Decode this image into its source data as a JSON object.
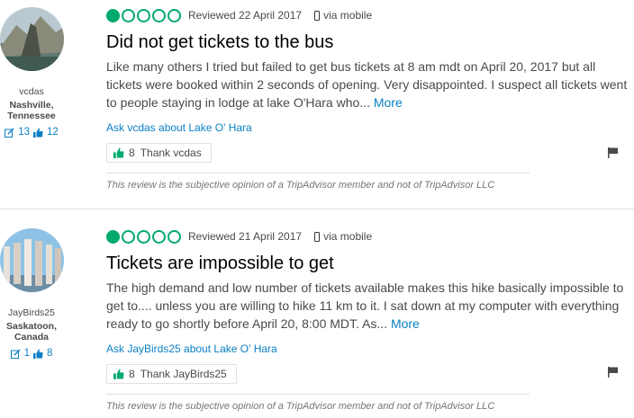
{
  "reviews": [
    {
      "username": "vcdas",
      "location": "Nashville, Tennessee",
      "contributions": "13",
      "helpful_votes": "12",
      "rating": 1,
      "max_rating": 5,
      "reviewed_date": "Reviewed 22 April 2017",
      "via": "via mobile",
      "title": "Did not get tickets to the bus",
      "body": "Like many others I tried but failed to get bus tickets at 8 am mdt on April 20, 2017 but all tickets were booked within 2 seconds of opening. Very disappointed. I suspect all tickets went to people staying in lodge at lake O'Hara who...",
      "more_label": "More",
      "ask_label": "Ask vcdas about Lake O' Hara",
      "thank_count": "8",
      "thank_label": "Thank vcdas",
      "disclaimer": "This review is the subjective opinion of a TripAdvisor member and not of TripAdvisor LLC"
    },
    {
      "username": "JayBirds25",
      "location": "Saskatoon, Canada",
      "contributions": "1",
      "helpful_votes": "8",
      "rating": 1,
      "max_rating": 5,
      "reviewed_date": "Reviewed 21 April 2017",
      "via": "via mobile",
      "title": "Tickets are impossible to get",
      "body": "The high demand and low number of tickets available makes this hike basically impossible to get to.... unless you are willing to hike 11 km to it. I sat down at my computer with everything ready to go shortly before April 20, 8:00 MDT. As...",
      "more_label": "More",
      "ask_label": "Ask JayBirds25 about Lake O' Hara",
      "thank_count": "8",
      "thank_label": "Thank JayBirds25",
      "disclaimer": "This review is the subjective opinion of a TripAdvisor member and not of TripAdvisor LLC"
    }
  ],
  "colors": {
    "accent": "#00aa6c",
    "link": "#0b7fc4"
  },
  "icons": {
    "contributions": "review-edit-icon",
    "helpful": "thumbs-up-icon",
    "device": "phone-icon",
    "report": "flag-icon"
  }
}
